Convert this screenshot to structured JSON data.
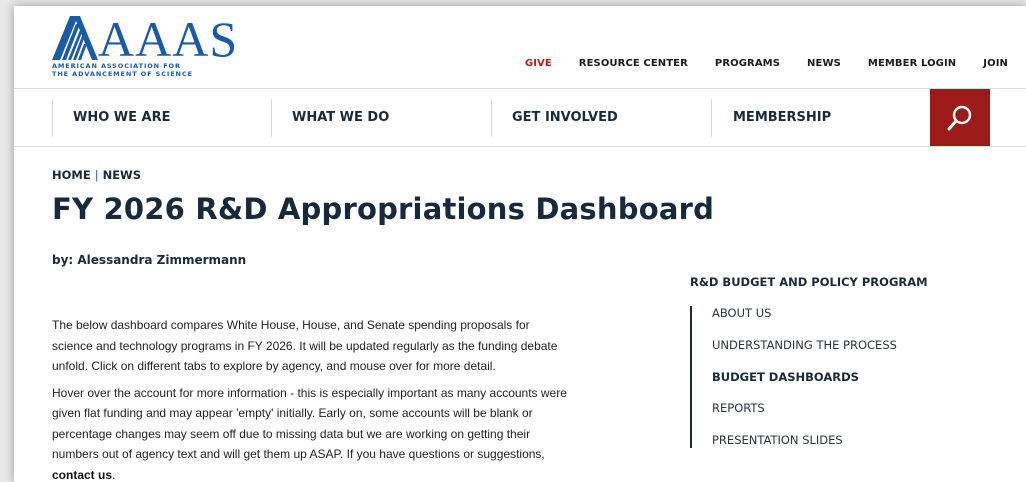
{
  "brand": {
    "name": "AAAS",
    "subtitle_line1": "AMERICAN ASSOCIATION FOR",
    "subtitle_line2": "THE ADVANCEMENT OF SCIENCE",
    "color": "#1d5aa6"
  },
  "top_nav": [
    {
      "label": "GIVE",
      "color": "#b01e1e"
    },
    {
      "label": "RESOURCE CENTER"
    },
    {
      "label": "PROGRAMS"
    },
    {
      "label": "NEWS"
    },
    {
      "label": "MEMBER LOGIN"
    },
    {
      "label": "JOIN"
    }
  ],
  "main_nav": [
    {
      "label": "WHO WE ARE"
    },
    {
      "label": "WHAT WE DO"
    },
    {
      "label": "GET INVOLVED"
    },
    {
      "label": "MEMBERSHIP"
    }
  ],
  "search": {
    "icon": "search-icon",
    "color": "#9b1b1b"
  },
  "breadcrumb": {
    "home": "HOME",
    "separator": "|",
    "current": "NEWS"
  },
  "article": {
    "title": "FY 2026 R&D Appropriations Dashboard",
    "byline": "by: Alessandra Zimmermann",
    "paragraph1": "The below dashboard compares White House, House, and Senate spending proposals for science and technology programs in FY 2026. It will be updated regularly as the funding debate unfold. Click on different tabs to explore by agency, and mouse over for more detail.",
    "paragraph2": "Hover over the account for more information - this is especially important as many accounts were given flat funding and may appear 'empty' initially. Early on, some accounts will be blank or percentage changes may seem off due to missing data but we are working on getting their numbers out of agency text and will get them up ASAP.  If you have questions or suggestions,",
    "contact_link": "contact us",
    "contact_suffix": "."
  },
  "sidebar": {
    "title": "R&D BUDGET AND POLICY PROGRAM",
    "items": [
      {
        "label": "ABOUT US"
      },
      {
        "label": "UNDERSTANDING THE PROCESS"
      },
      {
        "label": "BUDGET DASHBOARDS",
        "active": true
      },
      {
        "label": "REPORTS"
      },
      {
        "label": "PRESENTATION SLIDES"
      }
    ]
  }
}
